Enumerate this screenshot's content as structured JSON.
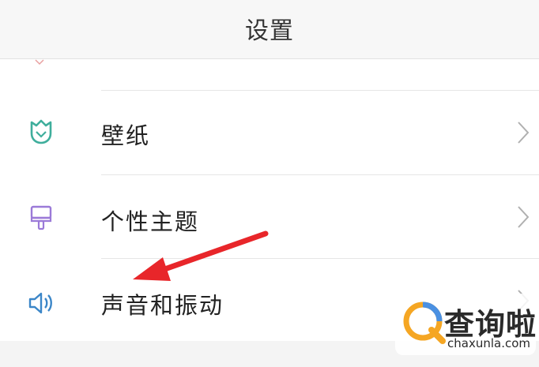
{
  "header": {
    "title": "设置"
  },
  "settings": {
    "items": [
      {
        "label": "壁纸",
        "icon": "tulip-icon",
        "icon_color": "#3fae9c"
      },
      {
        "label": "个性主题",
        "icon": "paintbrush-icon",
        "icon_color": "#9b7ad8"
      },
      {
        "label": "声音和振动",
        "icon": "speaker-icon",
        "icon_color": "#3b86c8"
      }
    ]
  },
  "annotation": {
    "arrow_color": "#e8262a"
  },
  "watermark": {
    "name": "查询啦",
    "url": "chaxunla.com"
  }
}
